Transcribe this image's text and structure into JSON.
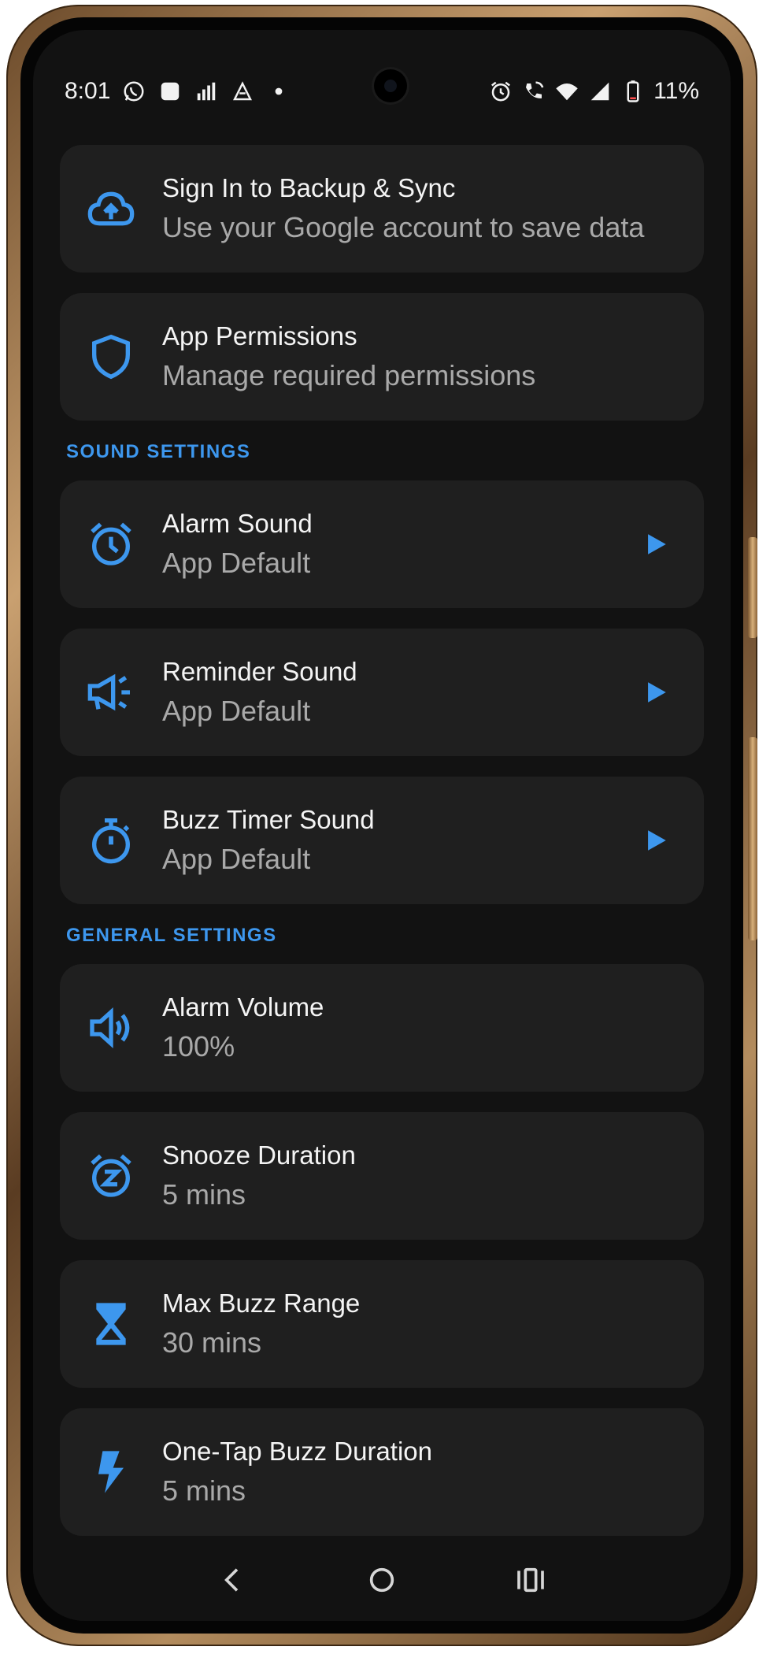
{
  "status_bar": {
    "time": "8:01",
    "battery": "11%",
    "left_icons": [
      "whatsapp-icon",
      "app-square-icon",
      "signal-app-icon",
      "shortcut-icon",
      "dot-icon"
    ],
    "right_icons": [
      "alarm-icon",
      "wifi-calling-icon",
      "wifi-icon",
      "cell-signal-icon",
      "battery-icon"
    ]
  },
  "account_cards": [
    {
      "title": "Sign In to Backup & Sync",
      "subtitle": "Use your Google account to save data",
      "icon": "cloud-upload-icon"
    },
    {
      "title": "App Permissions",
      "subtitle": "Manage required permissions",
      "icon": "shield-icon"
    }
  ],
  "sound_settings": {
    "header": "SOUND SETTINGS",
    "items": [
      {
        "title": "Alarm Sound",
        "subtitle": "App Default",
        "icon": "alarm-clock-icon",
        "action": "play-icon"
      },
      {
        "title": "Reminder Sound",
        "subtitle": "App Default",
        "icon": "megaphone-icon",
        "action": "play-icon"
      },
      {
        "title": "Buzz Timer Sound",
        "subtitle": "App Default",
        "icon": "stopwatch-icon",
        "action": "play-icon"
      }
    ]
  },
  "general_settings": {
    "header": "GENERAL SETTINGS",
    "items": [
      {
        "title": "Alarm Volume",
        "subtitle": "100%",
        "icon": "volume-icon"
      },
      {
        "title": "Snooze Duration",
        "subtitle": "5 mins",
        "icon": "snooze-icon"
      },
      {
        "title": "Max Buzz Range",
        "subtitle": "30 mins",
        "icon": "hourglass-icon"
      },
      {
        "title": "One-Tap Buzz Duration",
        "subtitle": "5 mins",
        "icon": "lightning-icon"
      }
    ]
  },
  "nav_bar": {
    "buttons": [
      "back-icon",
      "home-icon",
      "recents-icon"
    ]
  },
  "colors": {
    "accent": "#3d97ee",
    "background": "#121212",
    "card": "#1f1f1f",
    "title_text": "#f4f4f4",
    "subtitle_text": "#a9a9a9"
  }
}
